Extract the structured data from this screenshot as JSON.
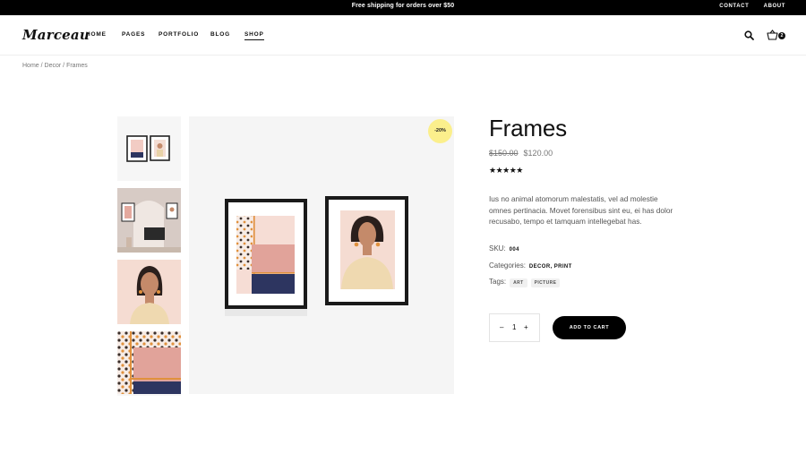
{
  "topbar": {
    "promo": "Free shipping for orders over $50",
    "links": [
      "CONTACT",
      "ABOUT"
    ]
  },
  "header": {
    "logo": "Marceau",
    "nav": [
      "HOME",
      "PAGES",
      "PORTFOLIO",
      "BLOG",
      "SHOP"
    ],
    "active_nav": "SHOP",
    "cart_count": "2",
    "icons": [
      "search-icon",
      "cart-icon"
    ]
  },
  "breadcrumb": {
    "items": [
      "Home",
      "Decor",
      "Frames"
    ],
    "separator": " / "
  },
  "gallery": {
    "badge": "-20%",
    "thumb_count": 4
  },
  "product": {
    "title": "Frames",
    "old_price": "$150.00",
    "price": "$120.00",
    "stars": "★★★★★",
    "rating": 5,
    "description": "Ius no animal atomorum malestatis, vel ad molestie omnes pertinacia. Movet forensibus sint eu, ei has dolor recusabo, tempo et tamquam intellegebat has.",
    "sku_label": "SKU:",
    "sku": "004",
    "categories_label": "Categories:",
    "categories": "DECOR, PRINT",
    "tags_label": "Tags:",
    "tags": [
      "ART",
      "PICTURE"
    ],
    "quantity": "1",
    "qty_minus": "–",
    "qty_plus": "+",
    "add_to_cart": "ADD TO CART"
  },
  "colors": {
    "badge": "#fbef8c",
    "accent": "#000000",
    "print_pink": "#e1a39a",
    "print_navy": "#2d3560",
    "print_orange": "#e0913d",
    "skin": "#c48a6a"
  }
}
